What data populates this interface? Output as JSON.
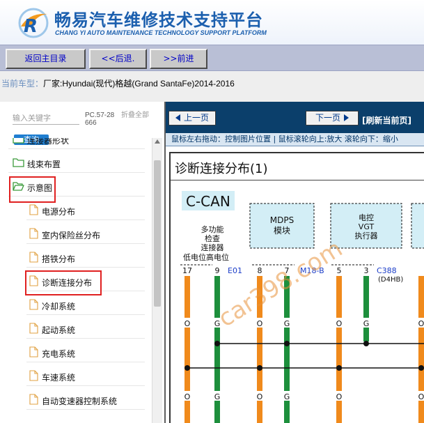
{
  "header": {
    "title": "畅易汽车维修技术支持平台",
    "subtitle": "CHANG YI AUTO MAINTENANCE TECHNOLOGY SUPPORT PLATFORM",
    "logo_icon": "cy-logo-icon"
  },
  "nav": {
    "home": "返回主目录",
    "back": "<<后退.",
    "forward": ">>前进"
  },
  "vehicle": {
    "label": "当前车型：",
    "value": "厂家:Hyundai(现代)格越(Grand SantaFe)2014-2016"
  },
  "left": {
    "search_placeholder": "输入关键字",
    "search_button": "查询",
    "pc_text": "PC.57-28666",
    "collapse_all": "折叠全部",
    "tree": [
      {
        "label": "连接器形状",
        "type": "folder"
      },
      {
        "label": "线束布置",
        "type": "folder"
      },
      {
        "label": "示意图",
        "type": "folder-open"
      },
      {
        "label": "电源分布",
        "type": "page"
      },
      {
        "label": "室内保险丝分布",
        "type": "page"
      },
      {
        "label": "搭铁分布",
        "type": "page"
      },
      {
        "label": "诊断连接分布",
        "type": "page"
      },
      {
        "label": "冷却系统",
        "type": "page"
      },
      {
        "label": "起动系统",
        "type": "page"
      },
      {
        "label": "充电系统",
        "type": "page"
      },
      {
        "label": "车速系统",
        "type": "page"
      },
      {
        "label": "自动变速器控制系统",
        "type": "page"
      }
    ]
  },
  "right": {
    "prev_page": "上一页",
    "next_page": "下一页",
    "refresh": "[刷新当前页]",
    "hint": "鼠标左右拖动：控制图片位置 | 鼠标滚轮向上:放大  滚轮向下：缩小",
    "diagram": {
      "title": "诊断连接分布(1)",
      "bus": "C-CAN",
      "module1": [
        "多功能",
        "检查",
        "连接器"
      ],
      "module1_pins": "低电位高电位",
      "module2": [
        "MDPS",
        "模块"
      ],
      "module3": [
        "电控",
        "VGT",
        "执行器"
      ],
      "pins": [
        "17",
        "9",
        "8",
        "7",
        "5",
        "3"
      ],
      "connectors": [
        "E01",
        "M18-B",
        "C388"
      ],
      "connector_note": "(D4HB)",
      "wire_o": "O",
      "wire_g": "G",
      "watermark": "car398.com",
      "colors": {
        "orange": "#f08a1c",
        "green": "#1d8f3c",
        "cyan": "#d3eef6",
        "blue": "#1a3cc8"
      }
    }
  }
}
